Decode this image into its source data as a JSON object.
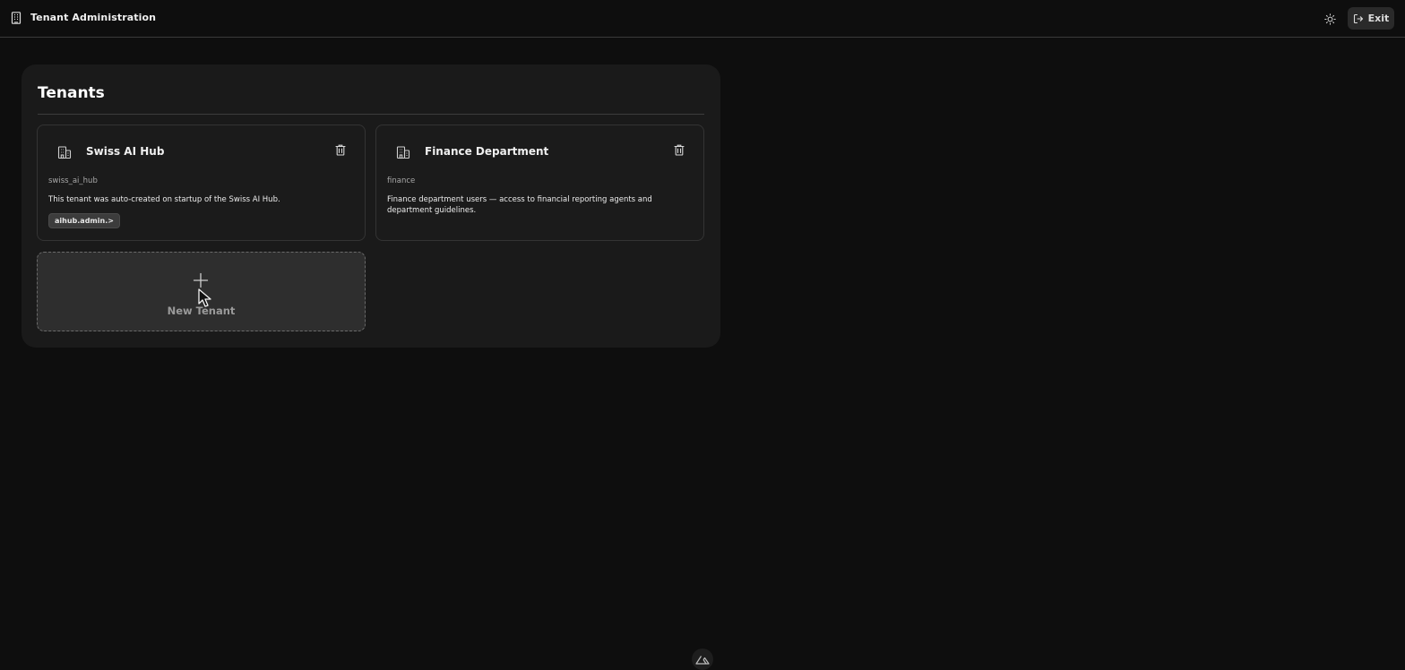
{
  "header": {
    "app_icon": "building-icon",
    "title": "Tenant Administration",
    "theme_icon": "sun-icon",
    "exit_icon": "logout-icon",
    "exit_label": "Exit"
  },
  "main": {
    "title": "Tenants",
    "tenants": [
      {
        "icon": "building-icon",
        "name": "Swiss AI Hub",
        "slug": "swiss_ai_hub",
        "description": "This tenant was auto-created on startup of the Swiss AI Hub.",
        "tag": "aihub.admin.>",
        "delete_icon": "trash-icon"
      },
      {
        "icon": "building-icon",
        "name": "Finance Department",
        "slug": "finance",
        "description": "Finance department users — access to financial reporting agents and department guidelines.",
        "delete_icon": "trash-icon"
      }
    ],
    "new_tenant": {
      "icon": "plus-icon",
      "label": "New Tenant"
    }
  },
  "footer": {
    "logo_icon": "nuxt-logo-icon"
  },
  "colors": {
    "background": "#0e0e0e",
    "panel": "#1a1a1a",
    "card_border": "#343434",
    "tag_bg": "#3c3c3c",
    "exit_bg": "#2a2a2a"
  }
}
